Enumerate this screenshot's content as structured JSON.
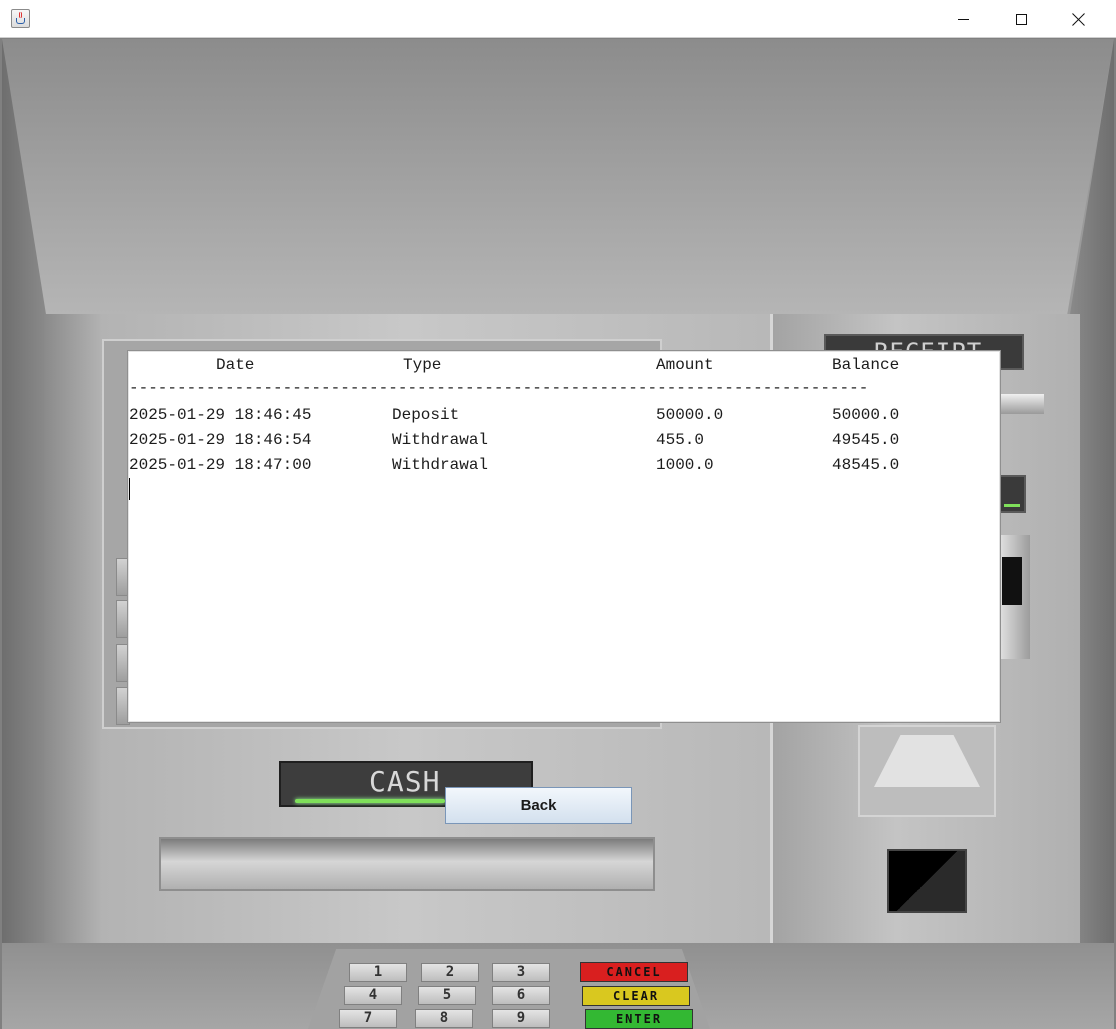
{
  "window": {
    "title": "",
    "icon": "java-cup-icon",
    "controls": {
      "minimize": "minimize-icon",
      "maximize": "maximize-icon",
      "close": "close-icon"
    }
  },
  "atm": {
    "receipt_label": "RECEIPT",
    "cash_label": "CASH",
    "keypad": {
      "digits": [
        "1",
        "2",
        "3",
        "4",
        "5",
        "6",
        "7",
        "8",
        "9"
      ],
      "cancel": "CANCEL",
      "clear": "CLEAR",
      "enter": "ENTER"
    },
    "colors": {
      "cancel": "#d91f1f",
      "clear": "#d9c81f",
      "enter": "#33b833",
      "led": "#7fe05a"
    }
  },
  "statement": {
    "headers": {
      "date": "Date",
      "type": "Type",
      "amount": "Amount",
      "balance": "Balance"
    },
    "separator": "-----------------------------------------------------------------------------",
    "rows": [
      {
        "date": "2025-01-29 18:46:45",
        "type": "Deposit",
        "amount": "50000.0",
        "balance": "50000.0"
      },
      {
        "date": "2025-01-29 18:46:54",
        "type": "Withdrawal",
        "amount": "455.0",
        "balance": "49545.0"
      },
      {
        "date": "2025-01-29 18:47:00",
        "type": "Withdrawal",
        "amount": "1000.0",
        "balance": "48545.0"
      }
    ]
  },
  "back_button": {
    "label": "Back"
  }
}
